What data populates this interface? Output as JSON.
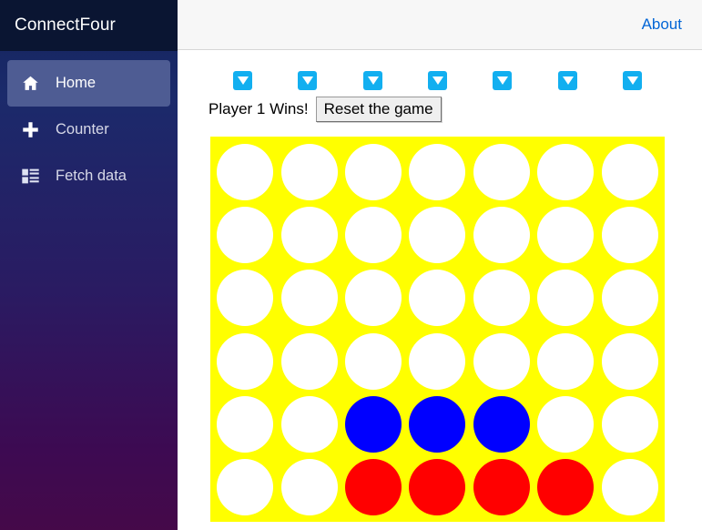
{
  "sidebar": {
    "brand": "ConnectFour",
    "items": [
      {
        "label": "Home",
        "icon": "home-icon",
        "active": true
      },
      {
        "label": "Counter",
        "icon": "plus-icon",
        "active": false
      },
      {
        "label": "Fetch data",
        "icon": "list-icon",
        "active": false
      }
    ]
  },
  "topbar": {
    "about_label": "About"
  },
  "game": {
    "status_text": "Player 1 Wins!",
    "reset_label": "Reset the game",
    "drop_button_icon": "caret-down-icon",
    "drop_button_count": 7,
    "columns": 7,
    "rows": 6,
    "board_color": "#ffff00",
    "empty_color": "#ffffff",
    "player1_color": "#ff0000",
    "player2_color": "#0000ff",
    "grid": [
      [
        "empty",
        "empty",
        "empty",
        "empty",
        "empty",
        "empty",
        "empty"
      ],
      [
        "empty",
        "empty",
        "empty",
        "empty",
        "empty",
        "empty",
        "empty"
      ],
      [
        "empty",
        "empty",
        "empty",
        "empty",
        "empty",
        "empty",
        "empty"
      ],
      [
        "empty",
        "empty",
        "empty",
        "empty",
        "empty",
        "empty",
        "empty"
      ],
      [
        "empty",
        "empty",
        "blue",
        "blue",
        "blue",
        "empty",
        "empty"
      ],
      [
        "empty",
        "empty",
        "red",
        "red",
        "red",
        "red",
        "empty"
      ]
    ]
  }
}
